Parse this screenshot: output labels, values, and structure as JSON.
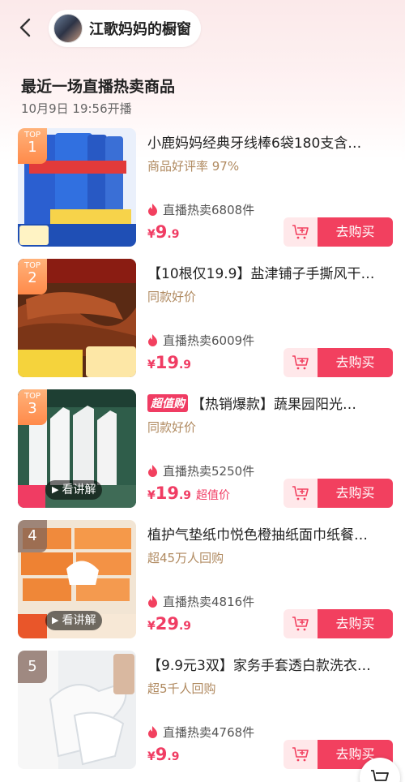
{
  "header": {
    "shop_name": "江歌妈妈的橱窗"
  },
  "section": {
    "title": "最近一场直播热卖商品",
    "subtitle": "10月9日 19:56开播"
  },
  "buy_label": "去购买",
  "explain_label": "看讲解",
  "chaozhi_tag": "超值购",
  "rank_top": "TOP",
  "colors": {
    "accent": "#f2405f",
    "cart_bg": "#ffe8ea",
    "rank": "#ff8a4a"
  },
  "items": [
    {
      "rank": "1",
      "title": "小鹿妈妈经典牙线棒6袋180支含…",
      "sub": "商品好评率 97%",
      "hot": "直播热卖6808件",
      "price_yen": "¥",
      "price_int": "9",
      "price_dec": ".9",
      "price_extra": ""
    },
    {
      "rank": "2",
      "title": "【10根仅19.9】盐津铺子手撕风干…",
      "sub": "同款好价",
      "hot": "直播热卖6009件",
      "price_yen": "¥",
      "price_int": "19",
      "price_dec": ".9",
      "price_extra": ""
    },
    {
      "rank": "3",
      "title": "【热销爆款】蔬果园阳光…",
      "sub": "同款好价",
      "hot": "直播热卖5250件",
      "price_yen": "¥",
      "price_int": "19",
      "price_dec": ".9",
      "price_extra": "超值价"
    },
    {
      "rank": "4",
      "title": "植护气垫纸巾悦色橙抽纸面巾纸餐…",
      "sub": "超45万人回购",
      "hot": "直播热卖4816件",
      "price_yen": "¥",
      "price_int": "29",
      "price_dec": ".9",
      "price_extra": ""
    },
    {
      "rank": "5",
      "title": "【9.9元3双】家务手套透白款洗衣…",
      "sub": "超5千人回购",
      "hot": "直播热卖4768件",
      "price_yen": "¥",
      "price_int": "9",
      "price_dec": ".9",
      "price_extra": ""
    }
  ]
}
